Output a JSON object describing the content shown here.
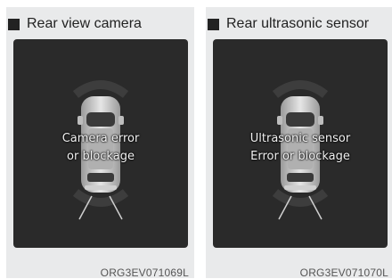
{
  "panels": [
    {
      "title": "Rear view camera",
      "message_line1": "Camera error",
      "message_line2": "or blockage",
      "code": "ORG3EV071069L"
    },
    {
      "title": "Rear ultrasonic sensor",
      "message_line1": "Ultrasonic sensor",
      "message_line2": "Error or blockage",
      "code": "ORG3EV071070L"
    }
  ],
  "colors": {
    "panel_background": "#e9eaeb",
    "screen_background": "#2a2a2a",
    "text_on_screen": "#f2f2f2"
  }
}
